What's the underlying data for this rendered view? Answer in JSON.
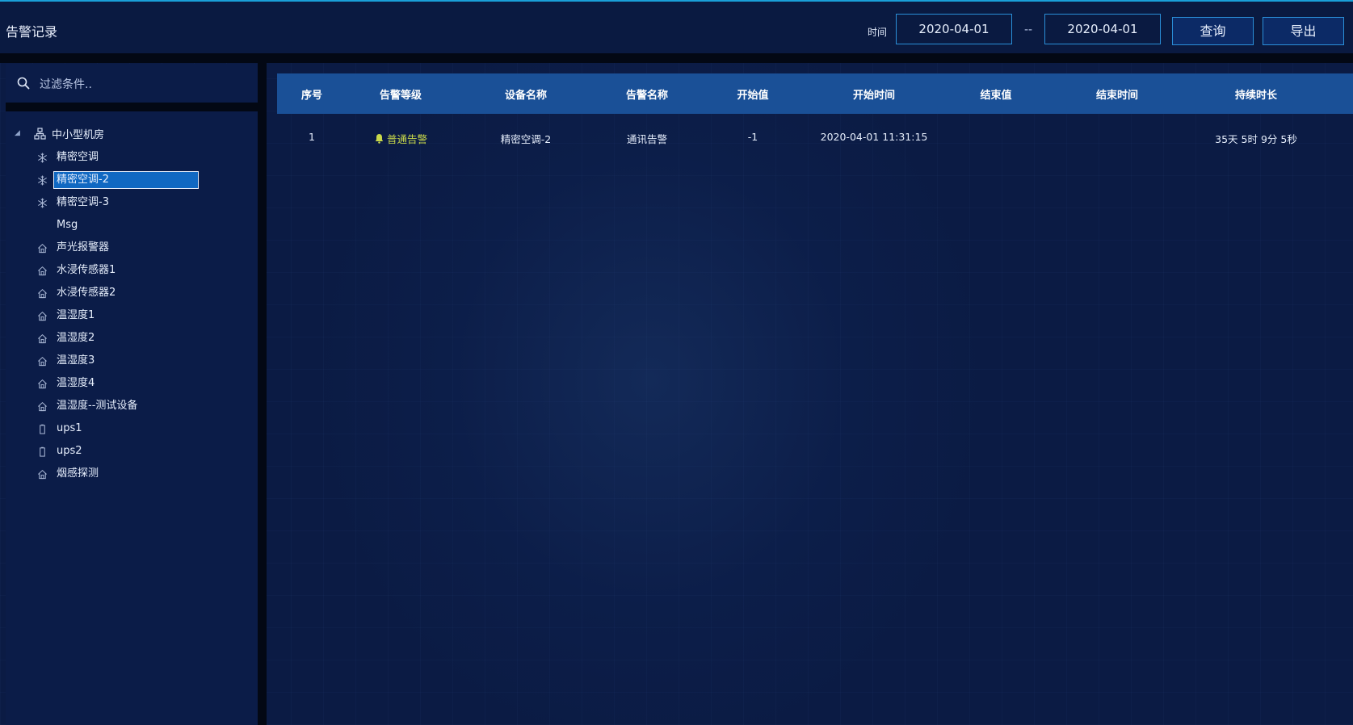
{
  "header": {
    "title": "告警记录",
    "time_label": "时间",
    "start_date": "2020-04-01",
    "date_separator": "--",
    "end_date": "2020-04-01",
    "query_label": "查询",
    "export_label": "导出"
  },
  "filter": {
    "placeholder": "过滤条件.."
  },
  "tree": {
    "root": {
      "label": "中小型机房",
      "icon": "org-chart-icon",
      "expanded": true
    },
    "items": [
      {
        "label": "精密空调",
        "icon": "snowflake-icon"
      },
      {
        "label": "精密空调-2",
        "icon": "snowflake-icon",
        "selected": true
      },
      {
        "label": "精密空调-3",
        "icon": "snowflake-icon"
      },
      {
        "label": "Msg",
        "icon": ""
      },
      {
        "label": "声光报警器",
        "icon": "house-icon"
      },
      {
        "label": "水浸传感器1",
        "icon": "house-icon"
      },
      {
        "label": "水浸传感器2",
        "icon": "house-icon"
      },
      {
        "label": "温湿度1",
        "icon": "house-icon"
      },
      {
        "label": "温湿度2",
        "icon": "house-icon"
      },
      {
        "label": "温湿度3",
        "icon": "house-icon"
      },
      {
        "label": "温湿度4",
        "icon": "house-icon"
      },
      {
        "label": "温湿度--测试设备",
        "icon": "house-icon"
      },
      {
        "label": "ups1",
        "icon": "battery-icon"
      },
      {
        "label": "ups2",
        "icon": "battery-icon"
      },
      {
        "label": "烟感探测",
        "icon": "house-icon"
      }
    ]
  },
  "table": {
    "columns": [
      "序号",
      "告警等级",
      "设备名称",
      "告警名称",
      "开始值",
      "开始时间",
      "结束值",
      "结束时间",
      "持续时长"
    ],
    "rows": [
      [
        "1",
        "普通告警",
        "精密空调-2",
        "通讯告警",
        "-1",
        "2020-04-01 11:31:15",
        "",
        "",
        "35天 5时 9分 5秒"
      ]
    ]
  },
  "colors": {
    "background": "#0b1b44",
    "accent": "#2a8fd8",
    "table_header": "#1a5097",
    "selected": "#1068c2",
    "alarm_normal": "#c9d94a"
  }
}
